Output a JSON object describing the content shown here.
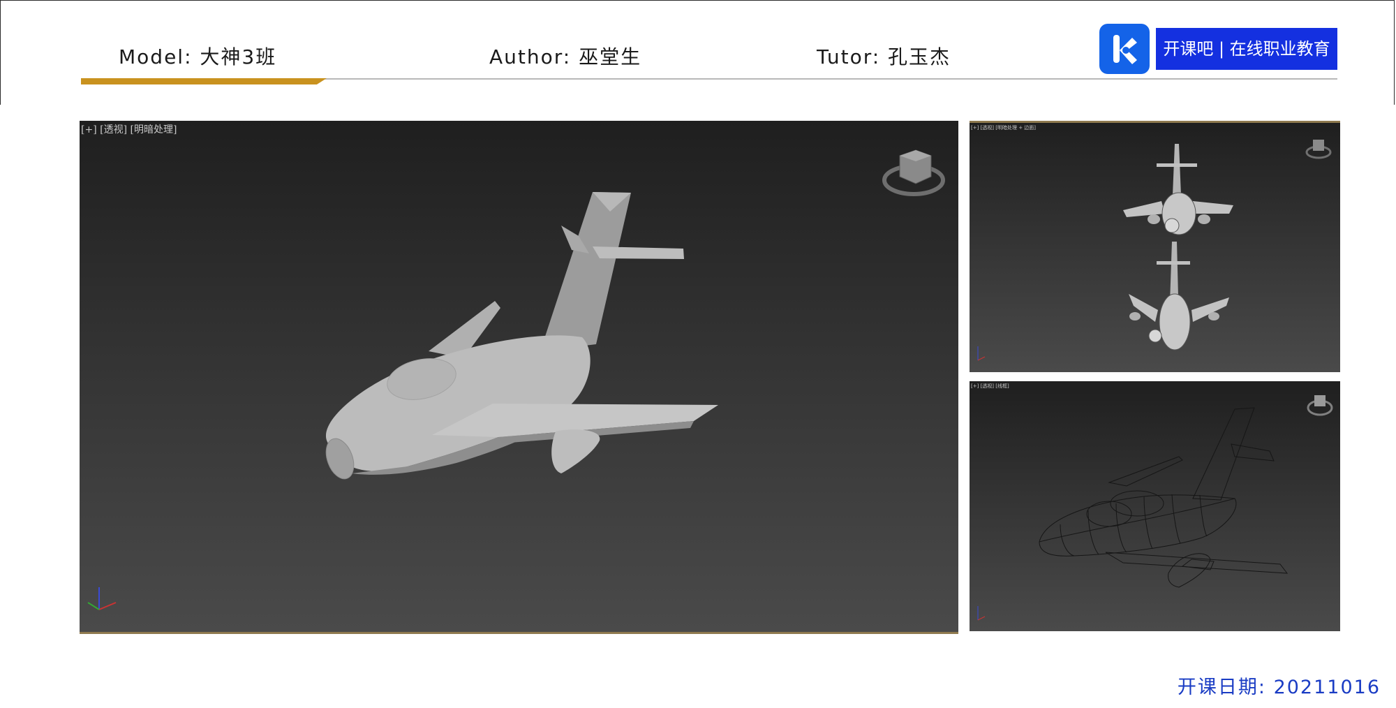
{
  "header": {
    "model": "Model:  大神3班",
    "author": "Author: 巫堂生",
    "tutor": "Tutor: 孔玉杰"
  },
  "logo": {
    "icon": "k-logo-icon",
    "text": "开课吧 | 在线职业教育",
    "colors": {
      "icon_bg": "#1463e8",
      "text_bg": "#1430e0",
      "text": "#ffffff"
    }
  },
  "viewports": {
    "main": {
      "label": "[+] [透视] [明暗处理]"
    },
    "top": {
      "label": "[+] [透视] [明暗处理 + 边面]"
    },
    "bottom": {
      "label": "[+] [透视] [线框]"
    }
  },
  "footer": {
    "date": "开课日期: 20211016"
  },
  "colors": {
    "accent_gold": "#c9921f",
    "date_blue": "#1a3cc4",
    "viewport_bg_dark": "#1f1f1f",
    "viewport_bg_light": "#4a4a4a"
  }
}
